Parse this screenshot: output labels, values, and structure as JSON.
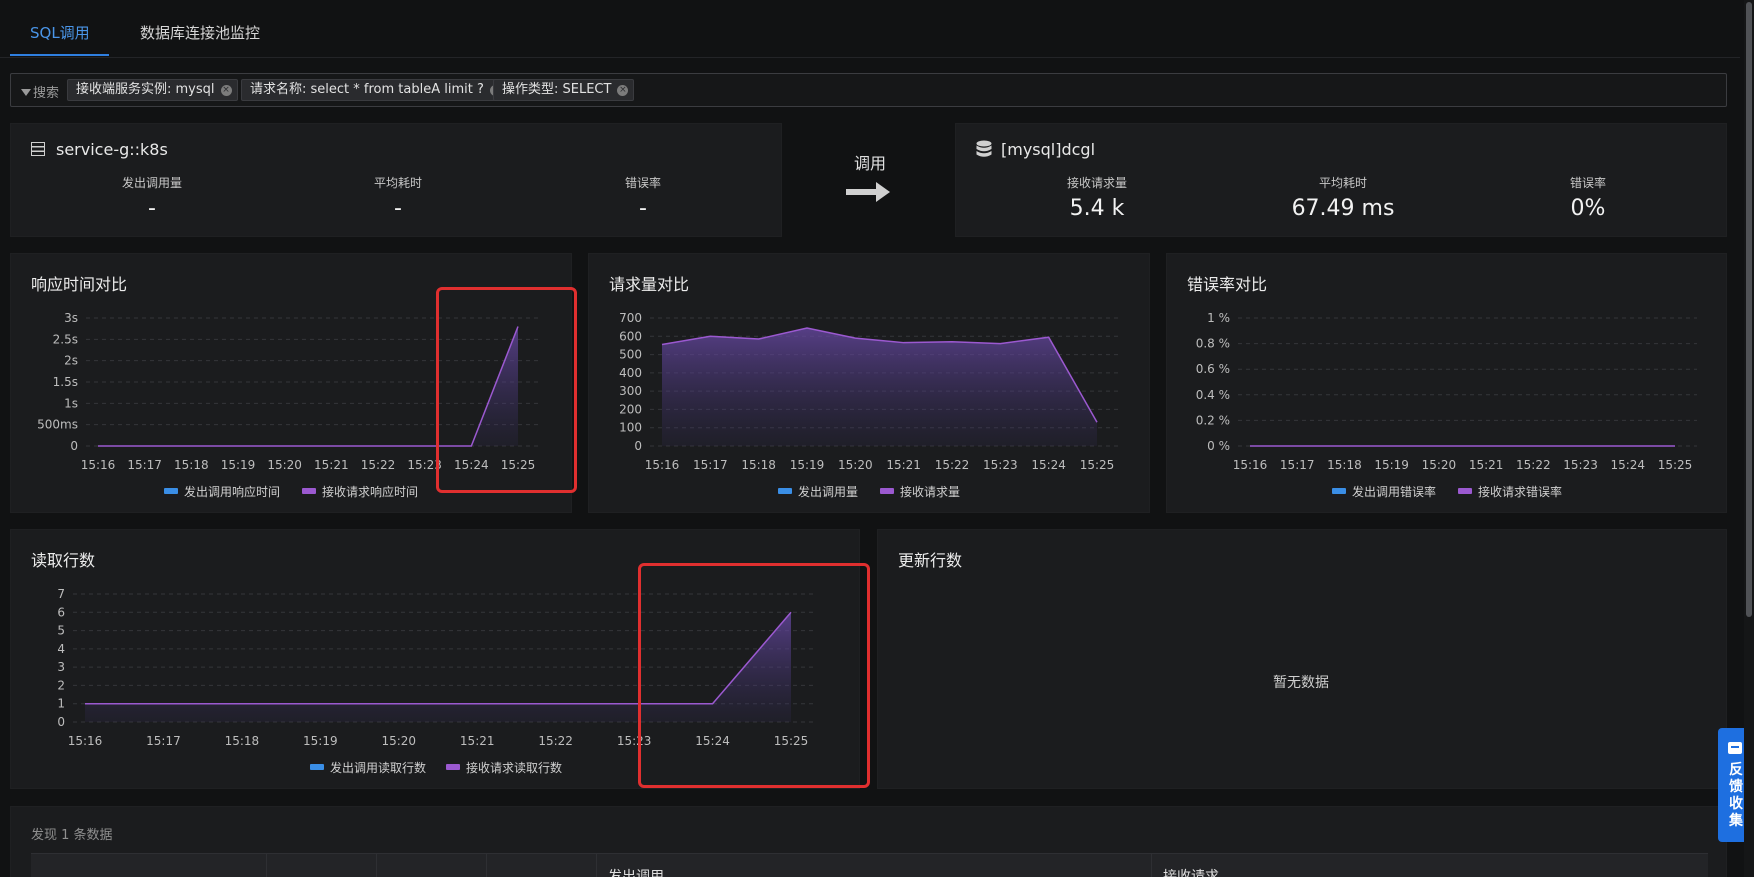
{
  "tabs": [
    {
      "label": "SQL调用",
      "active": true
    },
    {
      "label": "数据库连接池监控",
      "active": false
    }
  ],
  "filter": {
    "label": "搜索",
    "chips": [
      "接收端服务实例: mysql",
      "请求名称: select * from tableA limit ?",
      "操作类型: SELECT"
    ]
  },
  "source": {
    "name": "service-g::k8s",
    "metrics": [
      {
        "label": "发出调用量",
        "value": "-"
      },
      {
        "label": "平均耗时",
        "value": "-"
      },
      {
        "label": "错误率",
        "value": "-"
      }
    ]
  },
  "call_label": "调用",
  "target": {
    "name": "[mysql]dcgl",
    "metrics": [
      {
        "label": "接收请求量",
        "value": "5.4 k"
      },
      {
        "label": "平均耗时",
        "value": "67.49 ms"
      },
      {
        "label": "错误率",
        "value": "0%"
      }
    ]
  },
  "chart_data": [
    {
      "type": "area",
      "title": "响应时间对比",
      "x": [
        "15:16",
        "15:17",
        "15:18",
        "15:19",
        "15:20",
        "15:21",
        "15:22",
        "15:23",
        "15:24",
        "15:25"
      ],
      "y_ticks": [
        "0",
        "500ms",
        "1s",
        "1.5s",
        "2s",
        "2.5s",
        "3s"
      ],
      "ylim": [
        0,
        3000
      ],
      "y_unit": "ms",
      "series": [
        {
          "name": "发出调用响应时间",
          "color": "#3a8ee6",
          "values": []
        },
        {
          "name": "接收请求响应时间",
          "color": "#9b59d0",
          "values": [
            0,
            0,
            0,
            0,
            0,
            0,
            0,
            0,
            0,
            2800
          ]
        }
      ],
      "legend": "bottom"
    },
    {
      "type": "area",
      "title": "请求量对比",
      "x": [
        "15:16",
        "15:17",
        "15:18",
        "15:19",
        "15:20",
        "15:21",
        "15:22",
        "15:23",
        "15:24",
        "15:25"
      ],
      "y_ticks": [
        "0",
        "100",
        "200",
        "300",
        "400",
        "500",
        "600",
        "700"
      ],
      "ylim": [
        0,
        700
      ],
      "series": [
        {
          "name": "发出调用量",
          "color": "#3a8ee6",
          "values": []
        },
        {
          "name": "接收请求量",
          "color": "#9b59d0",
          "values": [
            555,
            600,
            585,
            645,
            590,
            565,
            570,
            560,
            595,
            130
          ]
        }
      ],
      "legend": "bottom"
    },
    {
      "type": "line",
      "title": "错误率对比",
      "x": [
        "15:16",
        "15:17",
        "15:18",
        "15:19",
        "15:20",
        "15:21",
        "15:22",
        "15:23",
        "15:24",
        "15:25"
      ],
      "y_ticks": [
        "0 %",
        "0.2 %",
        "0.4 %",
        "0.6 %",
        "0.8 %",
        "1 %"
      ],
      "ylim": [
        0,
        1
      ],
      "series": [
        {
          "name": "发出调用错误率",
          "color": "#3a8ee6",
          "values": []
        },
        {
          "name": "接收请求错误率",
          "color": "#9b59d0",
          "values": [
            0,
            0,
            0,
            0,
            0,
            0,
            0,
            0,
            0,
            0
          ]
        }
      ],
      "legend": "bottom"
    },
    {
      "type": "area",
      "title": "读取行数",
      "x": [
        "15:16",
        "15:17",
        "15:18",
        "15:19",
        "15:20",
        "15:21",
        "15:22",
        "15:23",
        "15:24",
        "15:25"
      ],
      "y_ticks": [
        "0",
        "1",
        "2",
        "3",
        "4",
        "5",
        "6",
        "7"
      ],
      "ylim": [
        0,
        7
      ],
      "series": [
        {
          "name": "发出调用读取行数",
          "color": "#3a8ee6",
          "values": []
        },
        {
          "name": "接收请求读取行数",
          "color": "#9b59d0",
          "values": [
            1,
            1,
            1,
            1,
            1,
            1,
            1,
            1,
            1,
            6
          ]
        }
      ],
      "legend": "bottom"
    }
  ],
  "update_rows": {
    "title": "更新行数",
    "empty_text": "暂无数据"
  },
  "table": {
    "found_text": "发现 1 条数据",
    "headers": [
      "发出调用",
      "接收请求"
    ]
  },
  "feedback": {
    "label": "反馈收集",
    "icon": "chat-icon"
  }
}
